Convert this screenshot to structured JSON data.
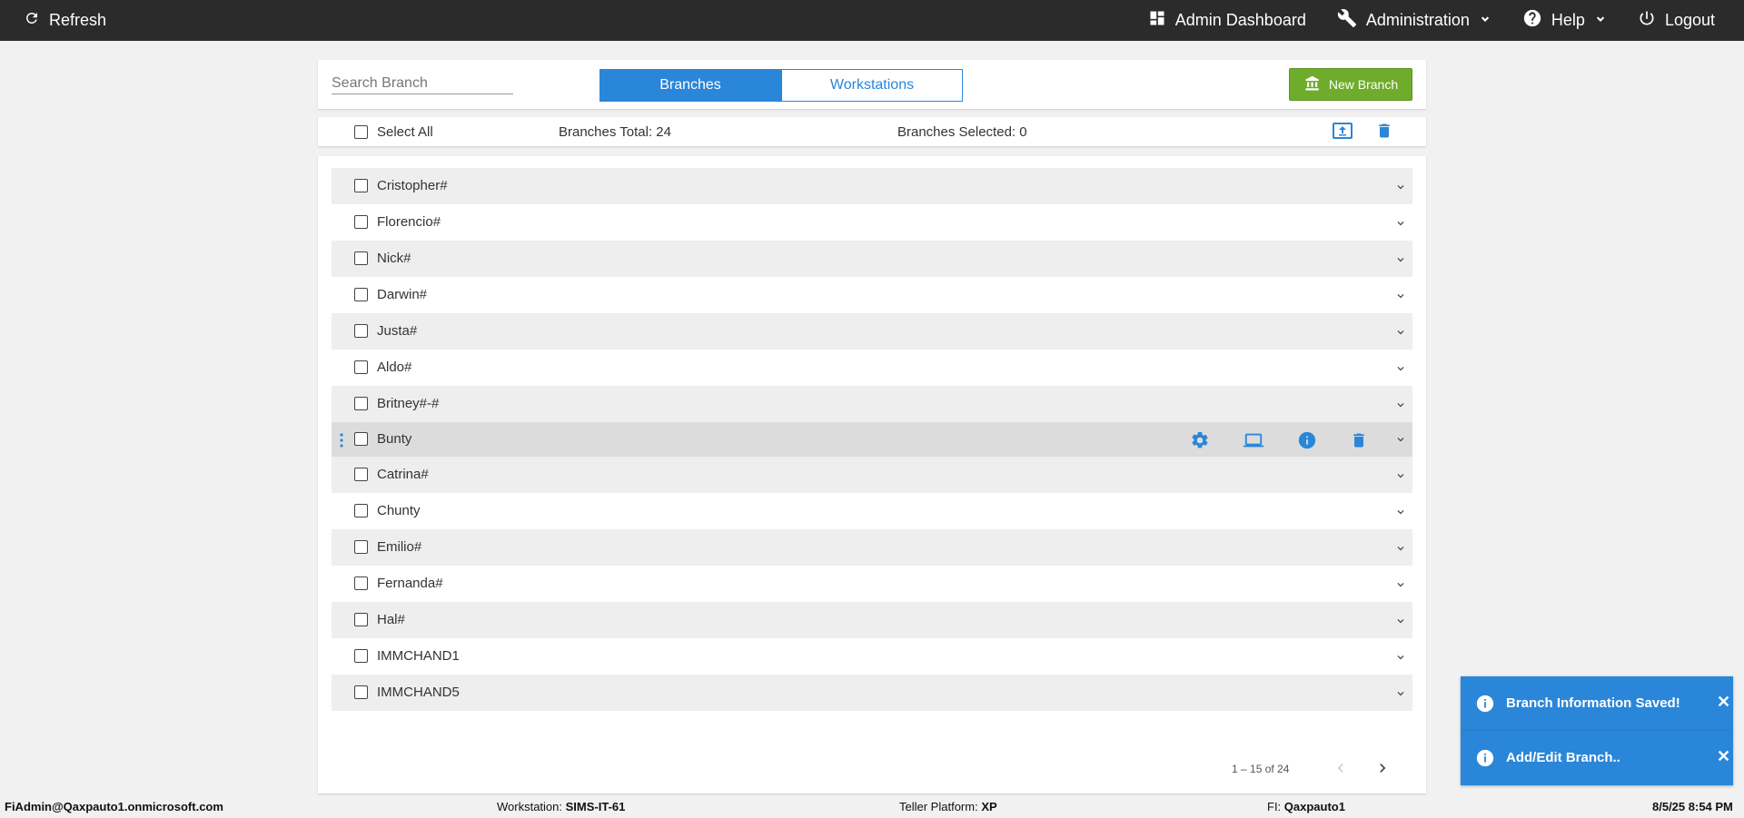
{
  "topbar": {
    "refresh_label": "Refresh",
    "admin_dashboard_label": "Admin Dashboard",
    "administration_label": "Administration",
    "help_label": "Help",
    "logout_label": "Logout"
  },
  "search": {
    "placeholder": "Search Branch",
    "value": ""
  },
  "tabs": [
    {
      "label": "Branches",
      "active": true
    },
    {
      "label": "Workstations",
      "active": false
    }
  ],
  "new_branch_label": "New Branch",
  "selection": {
    "select_all_label": "Select All",
    "total_text": "Branches Total: 24",
    "selected_text": "Branches Selected: 0"
  },
  "branches": [
    {
      "name": "Cristopher#"
    },
    {
      "name": "Florencio#"
    },
    {
      "name": "Nick#"
    },
    {
      "name": "Darwin#"
    },
    {
      "name": "Justa#"
    },
    {
      "name": "Aldo#"
    },
    {
      "name": "Britney#-#"
    },
    {
      "name": "Bunty"
    },
    {
      "name": "Catrina#"
    },
    {
      "name": "Chunty"
    },
    {
      "name": "Emilio#"
    },
    {
      "name": "Fernanda#"
    },
    {
      "name": "Hal#"
    },
    {
      "name": "IMMCHAND1"
    },
    {
      "name": "IMMCHAND5"
    }
  ],
  "pagination": {
    "label": "1 – 15 of 24"
  },
  "toasts": [
    {
      "message": "Branch Information Saved!"
    },
    {
      "message": "Add/Edit Branch.."
    }
  ],
  "status": {
    "user": "FiAdmin@Qaxpauto1.onmicrosoft.com",
    "workstation_label": "Workstation:",
    "workstation_value": "SIMS-IT-61",
    "platform_label": "Teller Platform:",
    "platform_value": "XP",
    "fi_label": "FI:",
    "fi_value": "Qaxpauto1",
    "datetime": "8/5/25 8:54 PM"
  },
  "colors": {
    "accent": "#2a86d8",
    "success": "#6fac2c",
    "topbar": "#2b2b2b"
  }
}
